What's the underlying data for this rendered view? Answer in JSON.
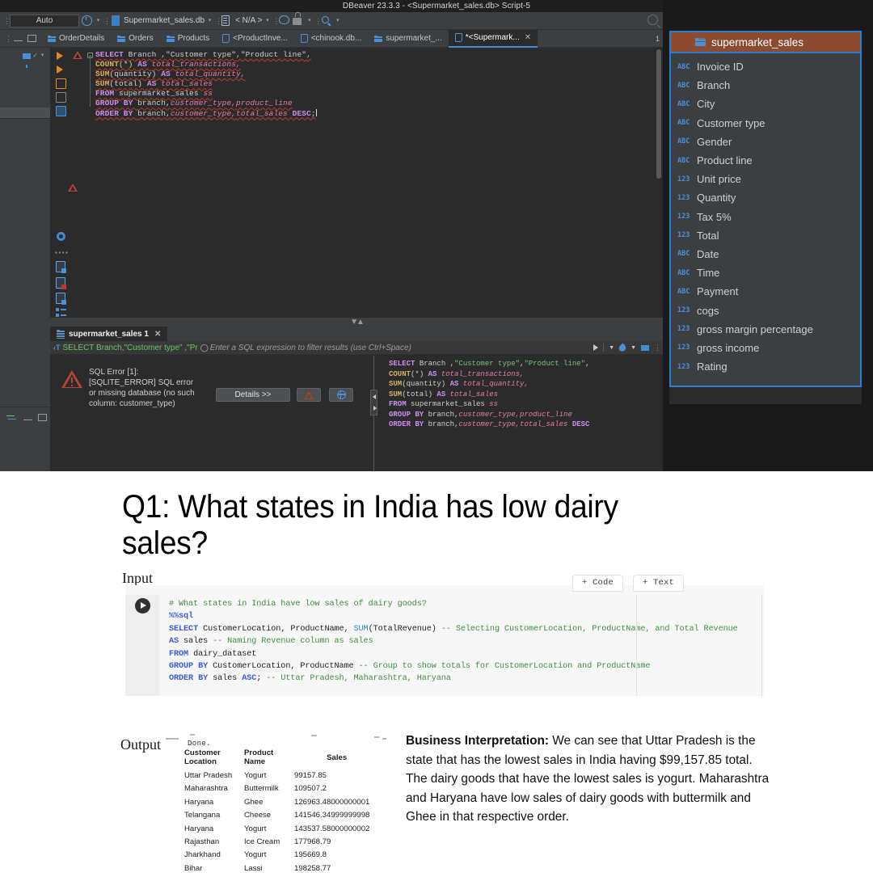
{
  "dbeaver": {
    "window_title": "DBeaver 23.3.3 - <Supermarket_sales.db> Script-5",
    "toolbar": {
      "auto_commit_label": "Auto",
      "connection_label": "Supermarket_sales.db",
      "schema_label": "< N/A >",
      "icons": [
        "clock-icon",
        "database-icon",
        "schema-icon",
        "cloud-icon",
        "lock-icon",
        "search-icon"
      ]
    },
    "tabs": [
      {
        "label": "OrderDetails",
        "icon": "grid-icon",
        "active": false
      },
      {
        "label": "Orders",
        "icon": "grid-icon",
        "active": false
      },
      {
        "label": "Products",
        "icon": "grid-icon",
        "active": false
      },
      {
        "label": "<ProductInve...",
        "icon": "sql-icon",
        "active": false
      },
      {
        "label": "<chinook.db...",
        "icon": "sql-icon",
        "active": false
      },
      {
        "label": "supermarket_...",
        "icon": "grid-icon",
        "active": false
      },
      {
        "label": "*<Supermark...",
        "icon": "sql-icon",
        "active": true
      }
    ],
    "tabstrip_overflow": "1",
    "editor_sql_lines": [
      [
        {
          "t": "SELECT ",
          "c": "kw"
        },
        {
          "t": "Branch ",
          "c": "id"
        },
        {
          "t": ",",
          "c": "op"
        },
        {
          "t": "\"Customer type\"",
          "c": "id"
        },
        {
          "t": ",",
          "c": "op"
        },
        {
          "t": "\"Product line\"",
          "c": "id"
        },
        {
          "t": ",",
          "c": "op"
        }
      ],
      [
        {
          "t": "COUNT",
          "c": "fn"
        },
        {
          "t": "(*) ",
          "c": "op"
        },
        {
          "t": "AS ",
          "c": "kw"
        },
        {
          "t": "total_transactions,",
          "c": "al"
        }
      ],
      [
        {
          "t": "SUM",
          "c": "fn"
        },
        {
          "t": "(quantity) ",
          "c": "op"
        },
        {
          "t": "AS ",
          "c": "kw"
        },
        {
          "t": "total_quantity,",
          "c": "al"
        }
      ],
      [
        {
          "t": "SUM",
          "c": "fn"
        },
        {
          "t": "(total) ",
          "c": "op"
        },
        {
          "t": "AS ",
          "c": "kw"
        },
        {
          "t": "total_sales",
          "c": "al"
        }
      ],
      [
        {
          "t": "FROM ",
          "c": "kw"
        },
        {
          "t": "supermarket_sales ",
          "c": "id"
        },
        {
          "t": "ss",
          "c": "al"
        }
      ],
      [
        {
          "t": "GROUP BY ",
          "c": "kw"
        },
        {
          "t": "branch,",
          "c": "id"
        },
        {
          "t": "customer_type,",
          "c": "al"
        },
        {
          "t": "product_line",
          "c": "al"
        }
      ],
      [
        {
          "t": "ORDER BY ",
          "c": "kw"
        },
        {
          "t": "branch,",
          "c": "id"
        },
        {
          "t": "customer_type,",
          "c": "al"
        },
        {
          "t": "total_sales ",
          "c": "al"
        },
        {
          "t": "DESC;",
          "c": "kw"
        }
      ]
    ],
    "results": {
      "tab_label": "supermarket_sales 1",
      "filter_selection": "SELECT Branch,\"Customer type\" ,\"Pr",
      "filter_placeholder": "Enter a SQL expression to filter results (use Ctrl+Space)",
      "error_text": "SQL Error [1]: [SQLITE_ERROR] SQL error or missing database (no such column: customer_type)",
      "details_button": "Details >>",
      "error_sql_lines": [
        [
          {
            "t": "SELECT ",
            "c": "kw"
          },
          {
            "t": "Branch ",
            "c": "id"
          },
          {
            "t": ",",
            "c": "op"
          },
          {
            "t": "\"Customer type\"",
            "c": "str"
          },
          {
            "t": ",",
            "c": "op"
          },
          {
            "t": "\"Product line\"",
            "c": "str"
          },
          {
            "t": ",",
            "c": "op"
          }
        ],
        [
          {
            "t": "COUNT",
            "c": "fn"
          },
          {
            "t": "(*) ",
            "c": "op"
          },
          {
            "t": "AS ",
            "c": "kw"
          },
          {
            "t": "total_transactions,",
            "c": "al"
          }
        ],
        [
          {
            "t": "SUM",
            "c": "fn"
          },
          {
            "t": "(quantity) ",
            "c": "op"
          },
          {
            "t": "AS ",
            "c": "kw"
          },
          {
            "t": "total_quantity,",
            "c": "al"
          }
        ],
        [
          {
            "t": "SUM",
            "c": "fn"
          },
          {
            "t": "(total) ",
            "c": "op"
          },
          {
            "t": "AS ",
            "c": "kw"
          },
          {
            "t": "total_sales",
            "c": "al"
          }
        ],
        [
          {
            "t": "FROM ",
            "c": "kw"
          },
          {
            "t": "supermarket_sales ",
            "c": "id"
          },
          {
            "t": "ss",
            "c": "al"
          }
        ],
        [
          {
            "t": "GROUP BY ",
            "c": "kw"
          },
          {
            "t": "branch,",
            "c": "id"
          },
          {
            "t": "customer_type,",
            "c": "al"
          },
          {
            "t": "product_line",
            "c": "al"
          }
        ],
        [
          {
            "t": "ORDER BY ",
            "c": "kw"
          },
          {
            "t": "branch,",
            "c": "id"
          },
          {
            "t": "customer_type,",
            "c": "al"
          },
          {
            "t": "total_sales ",
            "c": "al"
          },
          {
            "t": "DESC",
            "c": "kw"
          }
        ]
      ]
    },
    "metadata_panel": {
      "table_name": "supermarket_sales",
      "accent_border": "#2a7fd4",
      "header_bg": "#8c4b2f",
      "columns": [
        {
          "type": "ABC",
          "name": "Invoice ID"
        },
        {
          "type": "ABC",
          "name": "Branch"
        },
        {
          "type": "ABC",
          "name": "City"
        },
        {
          "type": "ABC",
          "name": "Customer type"
        },
        {
          "type": "ABC",
          "name": "Gender"
        },
        {
          "type": "ABC",
          "name": "Product line"
        },
        {
          "type": "123",
          "name": "Unit price"
        },
        {
          "type": "123",
          "name": "Quantity"
        },
        {
          "type": "123",
          "name": "Tax 5%"
        },
        {
          "type": "123",
          "name": "Total"
        },
        {
          "type": "ABC",
          "name": "Date"
        },
        {
          "type": "ABC",
          "name": "Time"
        },
        {
          "type": "ABC",
          "name": "Payment"
        },
        {
          "type": "123",
          "name": "cogs"
        },
        {
          "type": "123",
          "name": "gross margin percentage"
        },
        {
          "type": "123",
          "name": "gross income"
        },
        {
          "type": "123",
          "name": "Rating"
        }
      ]
    }
  },
  "document": {
    "question_title": "Q1: What states in India has low dairy sales?",
    "input_label": "Input",
    "output_label": "Output",
    "notebook": {
      "add_code_button": "+ Code",
      "add_text_button": "+ Text",
      "code_lines": [
        [
          {
            "t": "# What states in India have low sales of dairy goods?",
            "c": "com"
          }
        ],
        [
          {
            "t": "%%sql",
            "c": "mag"
          }
        ],
        [
          {
            "t": "SELECT",
            "c": "kw"
          },
          {
            "t": " CustomerLocation, ProductName, ",
            "c": "pl"
          },
          {
            "t": "SUM",
            "c": "fn"
          },
          {
            "t": "(TotalRevenue)",
            "c": "punc"
          },
          {
            "t": " -- Selecting CustomerLocation, ProductName, and Total Revenue",
            "c": "com"
          }
        ],
        [
          {
            "t": "AS",
            "c": "kw"
          },
          {
            "t": " sales ",
            "c": "pl"
          },
          {
            "t": "-- Naming Revenue column as sales",
            "c": "com"
          }
        ],
        [
          {
            "t": "FROM",
            "c": "kw"
          },
          {
            "t": " dairy_dataset",
            "c": "pl"
          }
        ],
        [
          {
            "t": "GROUP BY",
            "c": "kw"
          },
          {
            "t": " CustomerLocation, ProductName ",
            "c": "pl"
          },
          {
            "t": "-- Group to show totals for CustomerLocation and ProductName",
            "c": "com"
          }
        ],
        [
          {
            "t": "ORDER BY",
            "c": "kw"
          },
          {
            "t": " sales ",
            "c": "pl"
          },
          {
            "t": "ASC",
            "c": "kw"
          },
          {
            "t": ";",
            "c": "punc"
          },
          {
            "t": " -- Uttar Pradesh, Maharashtra, Haryana",
            "c": "com"
          }
        ]
      ]
    },
    "output": {
      "status": "Done.",
      "headers": [
        "Customer Location",
        "Product Name",
        "Sales"
      ],
      "rows": [
        [
          "Uttar Pradesh",
          "Yogurt",
          "99157.85"
        ],
        [
          "Maharashtra",
          "Buttermilk",
          "109507.2"
        ],
        [
          "Haryana",
          "Ghee",
          "126963.48000000001"
        ],
        [
          "Telangana",
          "Cheese",
          "141546.34999999998"
        ],
        [
          "Haryana",
          "Yogurt",
          "143537.58000000002"
        ],
        [
          "Rajasthan",
          "Ice Cream",
          "177968.79"
        ],
        [
          "Jharkhand",
          "Yogurt",
          "195669.8"
        ],
        [
          "Bihar",
          "Lassi",
          "198258.77"
        ]
      ]
    },
    "business_interpretation": {
      "label": "Business Interpretation:",
      "text": " We can see that Uttar Pradesh is the state that has the lowest sales in India having $99,157.85 total. The dairy goods that have the lowest sales is yogurt. Maharashtra and Haryana have low sales of dairy goods with buttermilk and Ghee in that respective order."
    }
  }
}
